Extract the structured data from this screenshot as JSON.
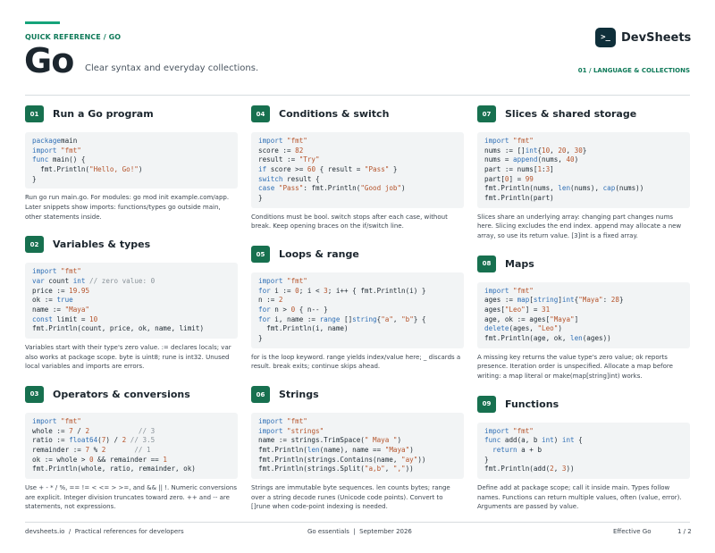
{
  "header": {
    "kicker": "QUICK REFERENCE / GO",
    "title": "Go",
    "subtitle": "Clear syntax and everyday collections.",
    "brand": "DevSheets",
    "brand_logo": ">_",
    "section_label": "01 / LANGUAGE & COLLECTIONS"
  },
  "sections": [
    {
      "num": "01",
      "title": "Run a Go program",
      "code": [
        [
          [
            "kw",
            "package"
          ],
          [
            "",
            "main"
          ]
        ],
        [
          [
            "kw",
            "import"
          ],
          [
            "",
            " "
          ],
          [
            "str",
            "\"fmt\""
          ]
        ],
        [
          [
            "kw",
            "func"
          ],
          [
            "",
            " main() {"
          ]
        ],
        [
          [
            "",
            "  fmt.Println("
          ],
          [
            "str",
            "\"Hello, Go!\""
          ],
          [
            "",
            ")"
          ]
        ],
        [
          [
            "",
            "}"
          ]
        ]
      ],
      "note": "Run go run main.go. For modules: go mod init example.com/app. Later snippets show imports: functions/types go outside main, other statements inside."
    },
    {
      "num": "02",
      "title": "Variables & types",
      "code": [
        [
          [
            "kw",
            "import"
          ],
          [
            "",
            " "
          ],
          [
            "str",
            "\"fmt\""
          ]
        ],
        [
          [
            "kw",
            "var"
          ],
          [
            "",
            " count "
          ],
          [
            "kw",
            "int"
          ],
          [
            "",
            " "
          ],
          [
            "cm",
            "// zero value: 0"
          ]
        ],
        [
          [
            "",
            "price := "
          ],
          [
            "num",
            "19.95"
          ]
        ],
        [
          [
            "",
            "ok := "
          ],
          [
            "kw",
            "true"
          ]
        ],
        [
          [
            "",
            "name := "
          ],
          [
            "str",
            "\"Maya\""
          ]
        ],
        [
          [
            "kw",
            "const"
          ],
          [
            "",
            " limit = "
          ],
          [
            "num",
            "10"
          ]
        ],
        [
          [
            "",
            "fmt.Println(count, price, ok, name, limit)"
          ]
        ]
      ],
      "note": "Variables start with their type's zero value. := declares locals; var also works at package scope. byte is uint8; rune is int32. Unused local variables and imports are errors."
    },
    {
      "num": "03",
      "title": "Operators & conversions",
      "code": [
        [
          [
            "kw",
            "import"
          ],
          [
            "",
            " "
          ],
          [
            "str",
            "\"fmt\""
          ]
        ],
        [
          [
            "",
            "whole := "
          ],
          [
            "num",
            "7"
          ],
          [
            "",
            " / "
          ],
          [
            "num",
            "2"
          ],
          [
            "",
            "            "
          ],
          [
            "cm",
            "// 3"
          ]
        ],
        [
          [
            "",
            "ratio := "
          ],
          [
            "kw",
            "float64"
          ],
          [
            "",
            "("
          ],
          [
            "num",
            "7"
          ],
          [
            "",
            ") / "
          ],
          [
            "num",
            "2"
          ],
          [
            "",
            " "
          ],
          [
            "cm",
            "// 3.5"
          ]
        ],
        [
          [
            "",
            "remainder := "
          ],
          [
            "num",
            "7"
          ],
          [
            "",
            " % "
          ],
          [
            "num",
            "2"
          ],
          [
            "",
            "       "
          ],
          [
            "cm",
            "// 1"
          ]
        ],
        [
          [
            "",
            "ok := whole > "
          ],
          [
            "num",
            "0"
          ],
          [
            "",
            " && remainder == "
          ],
          [
            "num",
            "1"
          ]
        ],
        [
          [
            "",
            "fmt.Println(whole, ratio, remainder, ok)"
          ]
        ]
      ],
      "note": "Use + - * / %, == != < <= > >=, and && || !. Numeric conversions are explicit. Integer division truncates toward zero. ++ and -- are statements, not expressions."
    },
    {
      "num": "04",
      "title": "Conditions & switch",
      "code": [
        [
          [
            "kw",
            "import"
          ],
          [
            "",
            " "
          ],
          [
            "str",
            "\"fmt\""
          ]
        ],
        [
          [
            "",
            "score := "
          ],
          [
            "num",
            "82"
          ]
        ],
        [
          [
            "",
            "result := "
          ],
          [
            "str",
            "\"Try\""
          ]
        ],
        [
          [
            "kw",
            "if"
          ],
          [
            "",
            " score >= "
          ],
          [
            "num",
            "60"
          ],
          [
            "",
            " { result = "
          ],
          [
            "str",
            "\"Pass\""
          ],
          [
            "",
            " }"
          ]
        ],
        [
          [
            "kw",
            "switch"
          ],
          [
            "",
            " result {"
          ]
        ],
        [
          [
            "kw",
            "case"
          ],
          [
            "",
            " "
          ],
          [
            "str",
            "\"Pass\""
          ],
          [
            "",
            ": fmt.Println("
          ],
          [
            "str",
            "\"Good job\""
          ],
          [
            "",
            ")"
          ]
        ],
        [
          [
            "",
            "}"
          ]
        ]
      ],
      "note": "Conditions must be bool. switch stops after each case, without break. Keep opening braces on the if/switch line."
    },
    {
      "num": "05",
      "title": "Loops & range",
      "code": [
        [
          [
            "kw",
            "import"
          ],
          [
            "",
            " "
          ],
          [
            "str",
            "\"fmt\""
          ]
        ],
        [
          [
            "kw",
            "for"
          ],
          [
            "",
            " i := "
          ],
          [
            "num",
            "0"
          ],
          [
            "",
            "; i < "
          ],
          [
            "num",
            "3"
          ],
          [
            "",
            "; i++ { fmt.Println(i) }"
          ]
        ],
        [
          [
            "",
            "n := "
          ],
          [
            "num",
            "2"
          ]
        ],
        [
          [
            "kw",
            "for"
          ],
          [
            "",
            " n > "
          ],
          [
            "num",
            "0"
          ],
          [
            "",
            " { n-- }"
          ]
        ],
        [
          [
            "kw",
            "for"
          ],
          [
            "",
            " i, name := "
          ],
          [
            "kw",
            "range"
          ],
          [
            "",
            " []"
          ],
          [
            "kw",
            "string"
          ],
          [
            "",
            "{"
          ],
          [
            "str",
            "\"a\""
          ],
          [
            "",
            ", "
          ],
          [
            "str",
            "\"b\""
          ],
          [
            "",
            "} {"
          ]
        ],
        [
          [
            "",
            "  fmt.Println(i, name)"
          ]
        ],
        [
          [
            "",
            "}"
          ]
        ]
      ],
      "note": "for is the loop keyword. range yields index/value here; _ discards a result. break exits; continue skips ahead."
    },
    {
      "num": "06",
      "title": "Strings",
      "code": [
        [
          [
            "kw",
            "import"
          ],
          [
            "",
            " "
          ],
          [
            "str",
            "\"fmt\""
          ]
        ],
        [
          [
            "kw",
            "import"
          ],
          [
            "",
            " "
          ],
          [
            "str",
            "\"strings\""
          ]
        ],
        [
          [
            "",
            "name := strings.TrimSpace("
          ],
          [
            "str",
            "\" Maya \""
          ],
          [
            "",
            ")"
          ]
        ],
        [
          [
            "",
            "fmt.Println("
          ],
          [
            "kw",
            "len"
          ],
          [
            "",
            "(name), name == "
          ],
          [
            "str",
            "\"Maya\""
          ],
          [
            "",
            ")"
          ]
        ],
        [
          [
            "",
            "fmt.Println(strings.Contains(name, "
          ],
          [
            "str",
            "\"ay\""
          ],
          [
            "",
            "))"
          ]
        ],
        [
          [
            "",
            "fmt.Println(strings.Split("
          ],
          [
            "str",
            "\"a,b\""
          ],
          [
            "",
            ", "
          ],
          [
            "str",
            "\",\""
          ],
          [
            "",
            "))"
          ]
        ]
      ],
      "note": "Strings are immutable byte sequences. len counts bytes; range over a string decode runes (Unicode code points). Convert to []rune when code-point indexing is needed."
    },
    {
      "num": "07",
      "title": "Slices & shared storage",
      "code": [
        [
          [
            "kw",
            "import"
          ],
          [
            "",
            " "
          ],
          [
            "str",
            "\"fmt\""
          ]
        ],
        [
          [
            "",
            "nums := []"
          ],
          [
            "kw",
            "int"
          ],
          [
            "",
            "{"
          ],
          [
            "num",
            "10"
          ],
          [
            "",
            ", "
          ],
          [
            "num",
            "20"
          ],
          [
            "",
            ", "
          ],
          [
            "num",
            "30"
          ],
          [
            "",
            "}"
          ]
        ],
        [
          [
            "",
            "nums = "
          ],
          [
            "kw",
            "append"
          ],
          [
            "",
            "(nums, "
          ],
          [
            "num",
            "40"
          ],
          [
            "",
            ")"
          ]
        ],
        [
          [
            "",
            "part := nums["
          ],
          [
            "num",
            "1"
          ],
          [
            "",
            ":"
          ],
          [
            "num",
            "3"
          ],
          [
            "",
            "]"
          ]
        ],
        [
          [
            "",
            "part["
          ],
          [
            "num",
            "0"
          ],
          [
            "",
            "] = "
          ],
          [
            "num",
            "99"
          ]
        ],
        [
          [
            "",
            "fmt.Println(nums, "
          ],
          [
            "kw",
            "len"
          ],
          [
            "",
            "(nums), "
          ],
          [
            "kw",
            "cap"
          ],
          [
            "",
            "(nums))"
          ]
        ],
        [
          [
            "",
            "fmt.Println(part)"
          ]
        ]
      ],
      "note": "Slices share an underlying array: changing part changes nums here. Slicing excludes the end index. append may allocate a new array, so use its return value. [3]int is a fixed array."
    },
    {
      "num": "08",
      "title": "Maps",
      "code": [
        [
          [
            "kw",
            "import"
          ],
          [
            "",
            " "
          ],
          [
            "str",
            "\"fmt\""
          ]
        ],
        [
          [
            "",
            "ages := "
          ],
          [
            "kw",
            "map"
          ],
          [
            "",
            "["
          ],
          [
            "kw",
            "string"
          ],
          [
            "",
            "]"
          ],
          [
            "kw",
            "int"
          ],
          [
            "",
            "{"
          ],
          [
            "str",
            "\"Maya\""
          ],
          [
            "",
            ": "
          ],
          [
            "num",
            "28"
          ],
          [
            "",
            "}"
          ]
        ],
        [
          [
            "",
            "ages["
          ],
          [
            "str",
            "\"Leo\""
          ],
          [
            "",
            "] = "
          ],
          [
            "num",
            "31"
          ]
        ],
        [
          [
            "",
            "age, ok := ages["
          ],
          [
            "str",
            "\"Maya\""
          ],
          [
            "",
            "]"
          ]
        ],
        [
          [
            "kw",
            "delete"
          ],
          [
            "",
            "(ages, "
          ],
          [
            "str",
            "\"Leo\""
          ],
          [
            "",
            ")"
          ]
        ],
        [
          [
            "",
            "fmt.Println(age, ok, "
          ],
          [
            "kw",
            "len"
          ],
          [
            "",
            "(ages))"
          ]
        ]
      ],
      "note": "A missing key returns the value type's zero value; ok reports presence. Iteration order is unspecified. Allocate a map before writing: a map literal or make(map[string]int) works."
    },
    {
      "num": "09",
      "title": "Functions",
      "code": [
        [
          [
            "kw",
            "import"
          ],
          [
            "",
            " "
          ],
          [
            "str",
            "\"fmt\""
          ]
        ],
        [
          [
            "kw",
            "func"
          ],
          [
            "",
            " add(a, b "
          ],
          [
            "kw",
            "int"
          ],
          [
            "",
            ") "
          ],
          [
            "kw",
            "int"
          ],
          [
            "",
            " {"
          ]
        ],
        [
          [
            "",
            "  "
          ],
          [
            "kw",
            "return"
          ],
          [
            "",
            " a + b"
          ]
        ],
        [
          [
            "",
            "}"
          ]
        ],
        [
          [
            "",
            "fmt.Println(add("
          ],
          [
            "num",
            "2"
          ],
          [
            "",
            ", "
          ],
          [
            "num",
            "3"
          ],
          [
            "",
            "))"
          ]
        ]
      ],
      "note": "Define add at package scope; call it inside main. Types follow names. Functions can return multiple values, often (value, error). Arguments are passed by value."
    }
  ],
  "footer": {
    "site": "devsheets.io",
    "separator": "/",
    "tagline": "Practical references for developers",
    "center": "Go essentials",
    "center_sep": "|",
    "date": "September 2026",
    "right": "Effective Go",
    "page": "1 / 2"
  },
  "colors": {
    "accent": "#15a37a",
    "badge": "#17704f",
    "keyword": "#2f6fb5",
    "string": "#b5532a"
  }
}
